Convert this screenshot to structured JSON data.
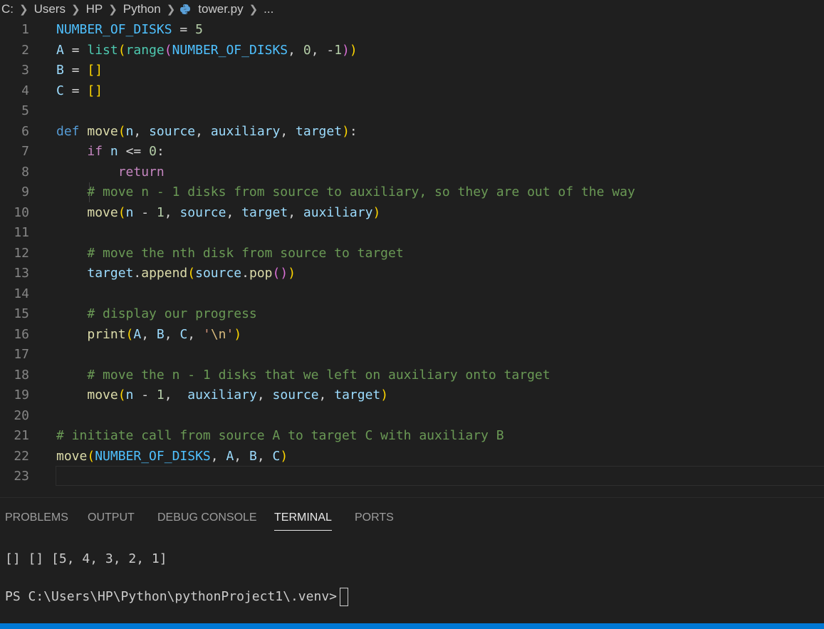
{
  "breadcrumb": {
    "drive": "C:",
    "folder1": "Users",
    "folder2": "HP",
    "folder3": "Python",
    "file": "tower.py",
    "more": "..."
  },
  "editor": {
    "line_numbers": [
      "1",
      "2",
      "3",
      "4",
      "5",
      "6",
      "7",
      "8",
      "9",
      "10",
      "11",
      "12",
      "13",
      "14",
      "15",
      "16",
      "17",
      "18",
      "19",
      "20",
      "21",
      "22",
      "23"
    ]
  },
  "panel": {
    "tabs": [
      "PROBLEMS",
      "OUTPUT",
      "DEBUG CONSOLE",
      "TERMINAL",
      "PORTS"
    ],
    "active_tab": "TERMINAL"
  },
  "terminal": {
    "output": "[] [] [5, 4, 3, 2, 1]",
    "prompt": "PS C:\\Users\\HP\\Python\\pythonProject1\\.venv>"
  },
  "colors": {
    "background": "#1f1f1f",
    "status_bar": "#0078d4",
    "keyword": "#569cd6",
    "comment": "#6a9955"
  }
}
